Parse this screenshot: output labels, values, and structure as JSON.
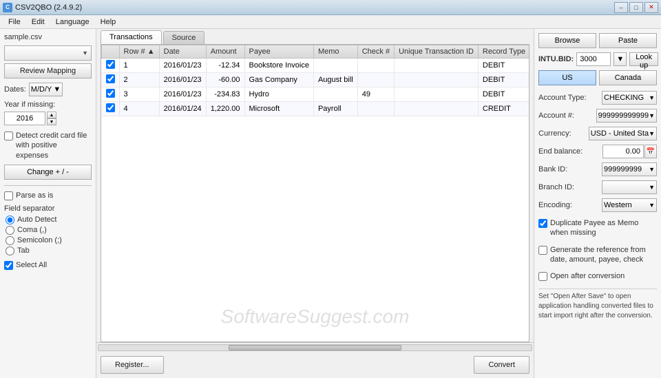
{
  "titlebar": {
    "icon": "C",
    "title": "CSV2QBO (2.4.9.2)",
    "min_label": "–",
    "max_label": "□",
    "close_label": "✕"
  },
  "menubar": {
    "items": [
      "File",
      "Edit",
      "Language",
      "Help"
    ]
  },
  "leftpanel": {
    "file_value": "sample.csv",
    "review_mapping_label": "Review Mapping",
    "dates_label": "Dates:",
    "dates_value": "M/D/Y",
    "year_missing_label": "Year if missing:",
    "year_value": "2016",
    "detect_credit_label": "Detect credit card file with positive expenses",
    "change_label": "Change + / -",
    "parse_label": "Parse as is",
    "field_separator_label": "Field separator",
    "auto_detect_label": "Auto Detect",
    "coma_label": "Coma (,)",
    "semicolon_label": "Semicolon (;)",
    "tab_label": "Tab",
    "select_all_label": "Select All"
  },
  "tabs": {
    "transactions_label": "Transactions",
    "source_label": "Source"
  },
  "table": {
    "headers": [
      "",
      "Row #",
      "Date",
      "Amount",
      "Payee",
      "Memo",
      "Check #",
      "Unique Transaction ID",
      "Record Type"
    ],
    "rows": [
      {
        "checked": true,
        "row": "1",
        "date": "2016/01/23",
        "amount": "-12.34",
        "payee": "Bookstore Invoice",
        "memo": "",
        "check": "",
        "utid": "",
        "record_type": "DEBIT"
      },
      {
        "checked": true,
        "row": "2",
        "date": "2016/01/23",
        "amount": "-60.00",
        "payee": "Gas Company",
        "memo": "August bill",
        "check": "",
        "utid": "",
        "record_type": "DEBIT"
      },
      {
        "checked": true,
        "row": "3",
        "date": "2016/01/23",
        "amount": "-234.83",
        "payee": "Hydro",
        "memo": "",
        "check": "49",
        "utid": "",
        "record_type": "DEBIT"
      },
      {
        "checked": true,
        "row": "4",
        "date": "2016/01/24",
        "amount": "1,220.00",
        "payee": "Microsoft",
        "memo": "Payroll",
        "check": "",
        "utid": "",
        "record_type": "CREDIT"
      }
    ]
  },
  "watermark": "SoftwareSuggest.com",
  "bottom": {
    "register_label": "Register...",
    "convert_label": "Convert"
  },
  "rightpanel": {
    "browse_label": "Browse",
    "paste_label": "Paste",
    "intu_label": "INTU.BID:",
    "intu_value": "3000",
    "intu_dropdown_value": "▼",
    "lookup_label": "Look up",
    "us_label": "US",
    "canada_label": "Canada",
    "account_type_label": "Account Type:",
    "account_type_value": "CHECKING",
    "account_num_label": "Account #:",
    "account_num_value": "999999999999",
    "currency_label": "Currency:",
    "currency_value": "USD - United Sta",
    "end_balance_label": "End balance:",
    "end_balance_value": "0.00",
    "bank_id_label": "Bank ID:",
    "bank_id_value": "999999999",
    "branch_id_label": "Branch ID:",
    "branch_id_value": "",
    "encoding_label": "Encoding:",
    "encoding_value": "Western",
    "dup_payee_label": "Duplicate Payee as Memo when missing",
    "gen_ref_label": "Generate the reference from date, amount, payee, check",
    "open_after_label": "Open after conversion",
    "info_text": "Set \"Open After Save\" to open application handling converted files to start import right after the conversion."
  }
}
